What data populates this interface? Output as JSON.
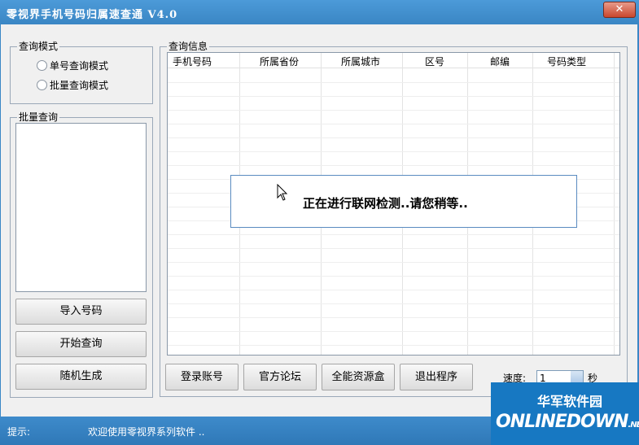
{
  "window": {
    "title": "零视界手机号码归属速查通 V4.0"
  },
  "query_mode": {
    "legend": "查询模式",
    "options": [
      "单号查询模式",
      "批量查询模式"
    ]
  },
  "batch": {
    "legend": "批量查询"
  },
  "left_buttons": {
    "import": "导入号码",
    "start": "开始查询",
    "random": "随机生成"
  },
  "results": {
    "legend": "查询信息",
    "columns": [
      "手机号码",
      "所属省份",
      "所属城市",
      "区号",
      "邮编",
      "号码类型"
    ]
  },
  "modal": {
    "message": "正在进行联网检测..请您稍等.."
  },
  "bottom_buttons": {
    "login": "登录账号",
    "forum": "官方论坛",
    "resource": "全能资源盒",
    "exit": "退出程序"
  },
  "speed": {
    "label": "速度:",
    "value": "1",
    "unit": "秒"
  },
  "status": {
    "label": "提示:",
    "message": "欢迎使用零视界系列软件 .."
  },
  "watermark": {
    "cn": "华军软件园",
    "en": "ONLINEDOWN",
    "suffix": ".NET"
  },
  "colors": {
    "titlebar": "#3a86c4",
    "close": "#c9472e",
    "watermark": "#1778c2"
  }
}
